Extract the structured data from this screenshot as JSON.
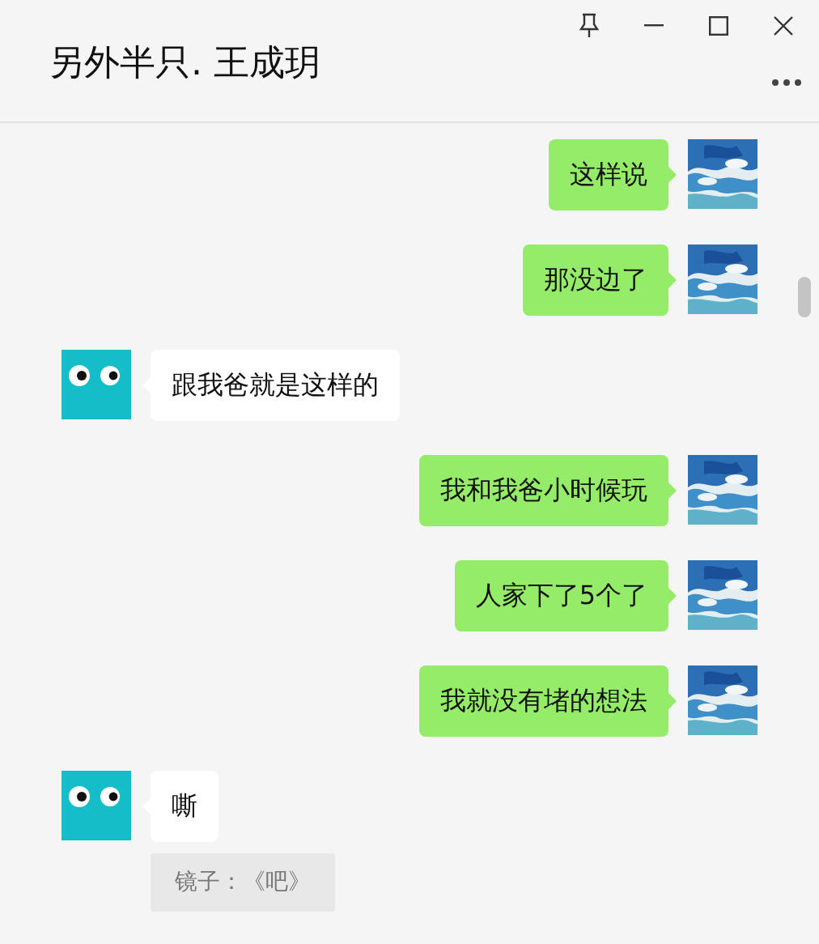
{
  "window": {
    "title": "另外半只. 王成玥"
  },
  "messages": [
    {
      "kind": "sent",
      "text": "这样说"
    },
    {
      "kind": "sent",
      "text": "那没边了"
    },
    {
      "kind": "received",
      "text": "跟我爸就是这样的"
    },
    {
      "kind": "sent",
      "text": "我和我爸小时候玩"
    },
    {
      "kind": "sent",
      "text": "人家下了5个了"
    },
    {
      "kind": "sent",
      "text": "我就没有堵的想法"
    },
    {
      "kind": "received",
      "text": "嘶",
      "quote": "镜子：《吧》"
    }
  ]
}
